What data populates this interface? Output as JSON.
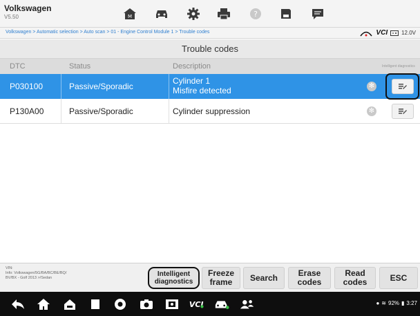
{
  "app": {
    "brand": "Volkswagen",
    "version": "V5.50"
  },
  "toolbar_icons": [
    "home-icon",
    "vehicle-icon",
    "settings-icon",
    "print-icon",
    "help-icon",
    "save-icon",
    "chat-icon"
  ],
  "breadcrumb": "Volkswagen > Automatic selection > Auto scan > 01 - Engine Control Module 1 > Trouble codes",
  "vci": {
    "logo": "VCI",
    "voltage": "12.0V"
  },
  "table": {
    "title": "Trouble codes",
    "headers": {
      "dtc": "DTC",
      "status": "Status",
      "description": "Description",
      "intelligent": "Intelligent diagnostics"
    },
    "rows": [
      {
        "dtc": "P030100",
        "status": "Passive/Sporadic",
        "desc_line1": "Cylinder 1",
        "desc_line2": "Misfire detected",
        "selected": true
      },
      {
        "dtc": "P130A00",
        "status": "Passive/Sporadic",
        "desc_line1": "Cylinder suppression",
        "desc_line2": "",
        "selected": false
      }
    ]
  },
  "vehicle_info": {
    "vin_label": "VIN:",
    "line1": "Info: Volkswagen/5G/BA/BC/BE/BQ/",
    "line2": "BV/BX - Golf 2013 >/Sedan"
  },
  "buttons": {
    "intelligent": {
      "l1": "Intelligent",
      "l2": "diagnostics"
    },
    "freeze": {
      "l1": "Freeze",
      "l2": "frame"
    },
    "search": "Search",
    "erase": {
      "l1": "Erase",
      "l2": "codes"
    },
    "read": {
      "l1": "Read",
      "l2": "codes"
    },
    "esc": "ESC"
  },
  "status_bar": {
    "battery": "92%",
    "time": "3:27"
  },
  "colors": {
    "accent": "#2f93e6",
    "nav_bg": "#0e0e0e"
  }
}
